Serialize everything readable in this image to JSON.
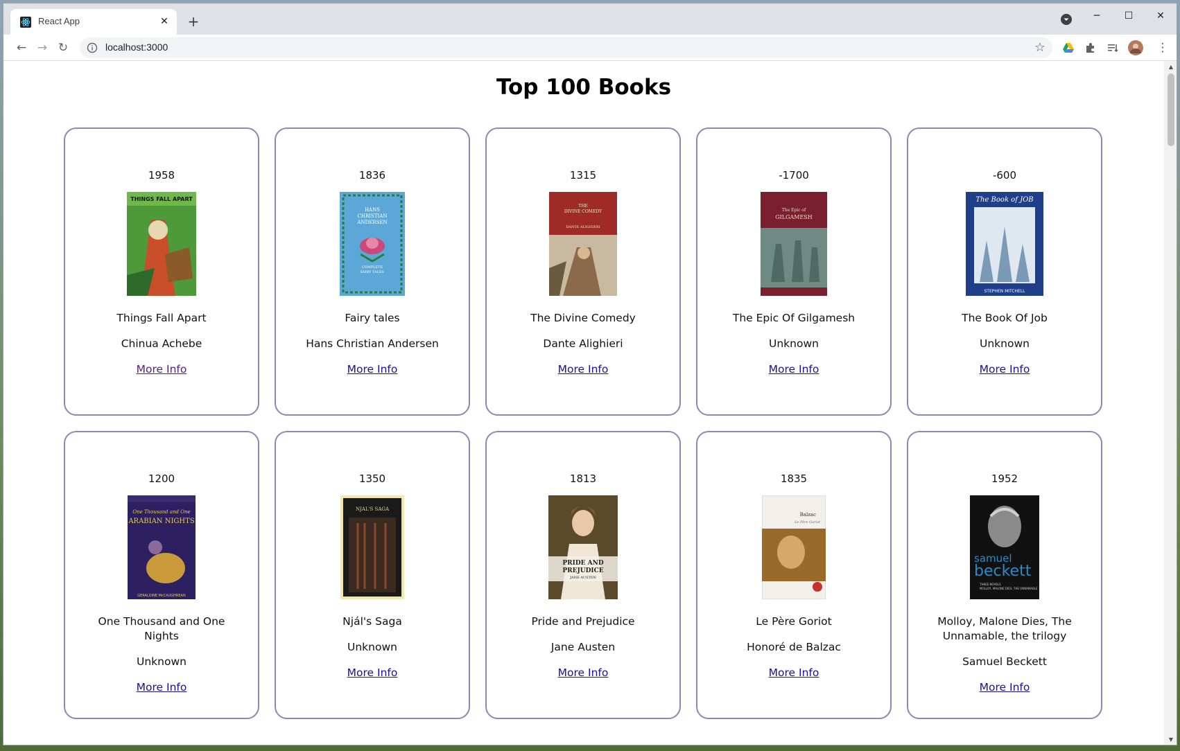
{
  "browser": {
    "tab_title": "React App",
    "url": "localhost:3000"
  },
  "page": {
    "title": "Top 100 Books"
  },
  "books": [
    {
      "year": "1958",
      "title": "Things Fall Apart",
      "author": "Chinua Achebe",
      "link": "More Info",
      "cover_colors": [
        "#4e9a3a",
        "#c94f2a"
      ]
    },
    {
      "year": "1836",
      "title": "Fairy tales",
      "author": "Hans Christian Andersen",
      "link": "More Info",
      "cover_colors": [
        "#5ba8d8",
        "#c84a7a"
      ]
    },
    {
      "year": "1315",
      "title": "The Divine Comedy",
      "author": "Dante Alighieri",
      "link": "More Info",
      "cover_colors": [
        "#9e2b25",
        "#c8b9a0"
      ]
    },
    {
      "year": "-1700",
      "title": "The Epic Of Gilgamesh",
      "author": "Unknown",
      "link": "More Info",
      "cover_colors": [
        "#7a1f2e",
        "#6f8a82"
      ]
    },
    {
      "year": "-600",
      "title": "The Book Of Job",
      "author": "Unknown",
      "link": "More Info",
      "cover_colors": [
        "#1f3f8a",
        "#dfe8f0"
      ]
    },
    {
      "year": "1200",
      "title": "One Thousand and One Nights",
      "author": "Unknown",
      "link": "More Info",
      "cover_colors": [
        "#2c2060",
        "#c89a3a"
      ]
    },
    {
      "year": "1350",
      "title": "Njál's Saga",
      "author": "Unknown",
      "link": "More Info",
      "cover_colors": [
        "#1a1a1a",
        "#8a4a2a"
      ]
    },
    {
      "year": "1813",
      "title": "Pride and Prejudice",
      "author": "Jane Austen",
      "link": "More Info",
      "cover_colors": [
        "#5a4a2a",
        "#efe6d8"
      ]
    },
    {
      "year": "1835",
      "title": "Le Père Goriot",
      "author": "Honoré de Balzac",
      "link": "More Info",
      "cover_colors": [
        "#f2f0ea",
        "#9a6a2a"
      ]
    },
    {
      "year": "1952",
      "title": "Molloy, Malone Dies, The Unnamable, the trilogy",
      "author": "Samuel Beckett",
      "link": "More Info",
      "cover_colors": [
        "#111111",
        "#2a8ac8"
      ]
    }
  ]
}
